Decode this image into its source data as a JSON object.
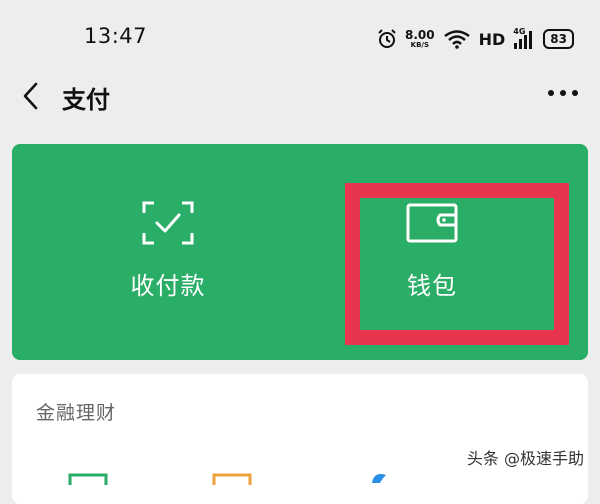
{
  "status_bar": {
    "time": "13:47",
    "net_speed_value": "8.00",
    "net_speed_unit": "KB/S",
    "hd": "HD",
    "network": "4G",
    "battery": "83"
  },
  "header": {
    "title": "支付"
  },
  "pay_card": {
    "collect_label": "收付款",
    "wallet_label": "钱包",
    "background": "#2aae67",
    "highlight_color": "#e8344f"
  },
  "finance": {
    "section_title": "金融理财"
  },
  "watermark": "头条 @极速手助",
  "icons": {
    "back": "back-arrow-icon",
    "more": "more-icon",
    "collect": "scan-check-icon",
    "wallet": "wallet-icon"
  }
}
